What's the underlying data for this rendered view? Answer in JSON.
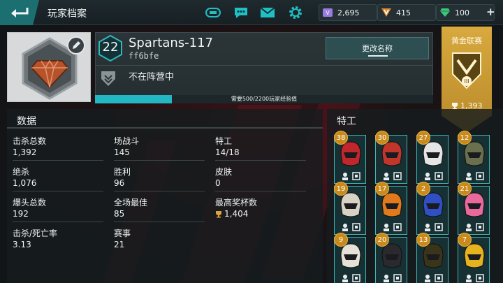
{
  "topbar": {
    "title": "玩家档案",
    "icons": [
      "game-controller-icon",
      "chat-icon",
      "mail-icon",
      "settings-gear-icon"
    ],
    "currencies": [
      {
        "name": "vip-points",
        "value": "2,695",
        "color": "#9a7be0"
      },
      {
        "name": "credits",
        "value": "415",
        "color": "#e0892c"
      },
      {
        "name": "gems",
        "value": "100",
        "color": "#3fc47a"
      }
    ],
    "add_label": "+"
  },
  "profile": {
    "level": "22",
    "name": "Spartans-117",
    "tag": "ff6bfe",
    "rename_label": "更改名称",
    "status": "不在阵营中",
    "xp_text": "需要500/2200玩家经验值",
    "xp_progress": 0.227
  },
  "league": {
    "label": "黄金联赛",
    "trophies": "1,393",
    "rank": "III"
  },
  "stats": {
    "title": "数据",
    "items": [
      {
        "label": "击杀总数",
        "value": "1,392"
      },
      {
        "label": "场战斗",
        "value": "145"
      },
      {
        "label": "特工",
        "value": "14/18"
      },
      {
        "label": "绝杀",
        "value": "1,076"
      },
      {
        "label": "胜利",
        "value": "96"
      },
      {
        "label": "皮肤",
        "value": "0"
      },
      {
        "label": "爆头总数",
        "value": "192"
      },
      {
        "label": "全场最佳",
        "value": "85"
      },
      {
        "label": "最高奖杯数",
        "value": "1,404"
      },
      {
        "label": "击杀/死亡率",
        "value": "3.13"
      },
      {
        "label": "赛事",
        "value": "21"
      }
    ]
  },
  "agents": {
    "title": "特工",
    "cards": [
      {
        "level": "38",
        "color": "#c0262b"
      },
      {
        "level": "30",
        "color": "#c0362b"
      },
      {
        "level": "27",
        "color": "#e5e5e5"
      },
      {
        "level": "12",
        "color": "#6a6f4e"
      },
      {
        "level": "19",
        "color": "#d8d2c4"
      },
      {
        "level": "17",
        "color": "#e07a1c"
      },
      {
        "level": "2",
        "color": "#2f4fc4"
      },
      {
        "level": "21",
        "color": "#e86a9c"
      },
      {
        "level": "9",
        "color": "#e6e1d6"
      },
      {
        "level": "20",
        "color": "#2a2a2e"
      },
      {
        "level": "13",
        "color": "#3a3418"
      },
      {
        "level": "7",
        "color": "#e6b21e"
      }
    ]
  }
}
